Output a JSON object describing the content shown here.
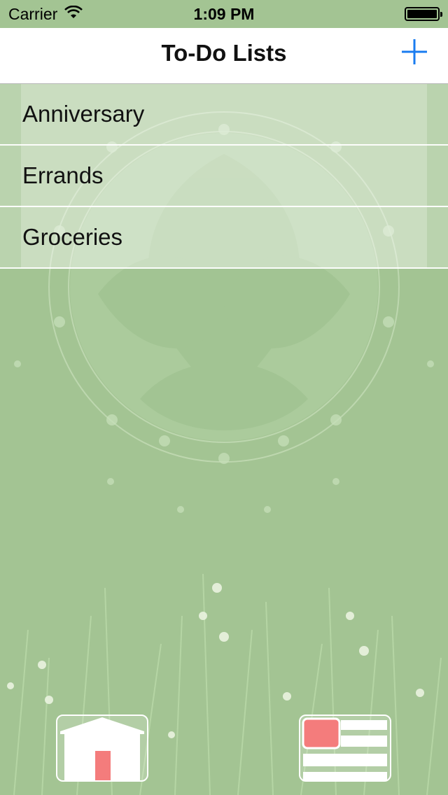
{
  "status_bar": {
    "carrier": "Carrier",
    "time": "1:09 PM",
    "battery_level": 1.0
  },
  "nav": {
    "title": "To-Do Lists",
    "add_icon": "plus-icon",
    "accent_color": "#1a7cf0"
  },
  "lists": [
    {
      "label": "Anniversary"
    },
    {
      "label": "Errands"
    },
    {
      "label": "Groceries"
    }
  ],
  "toolbar": {
    "home_icon": "house-icon",
    "lists_icon": "list-icon",
    "highlight_color": "#f47c7c"
  },
  "theme": {
    "background": "#a3c493",
    "header_background": "#ffffff"
  }
}
